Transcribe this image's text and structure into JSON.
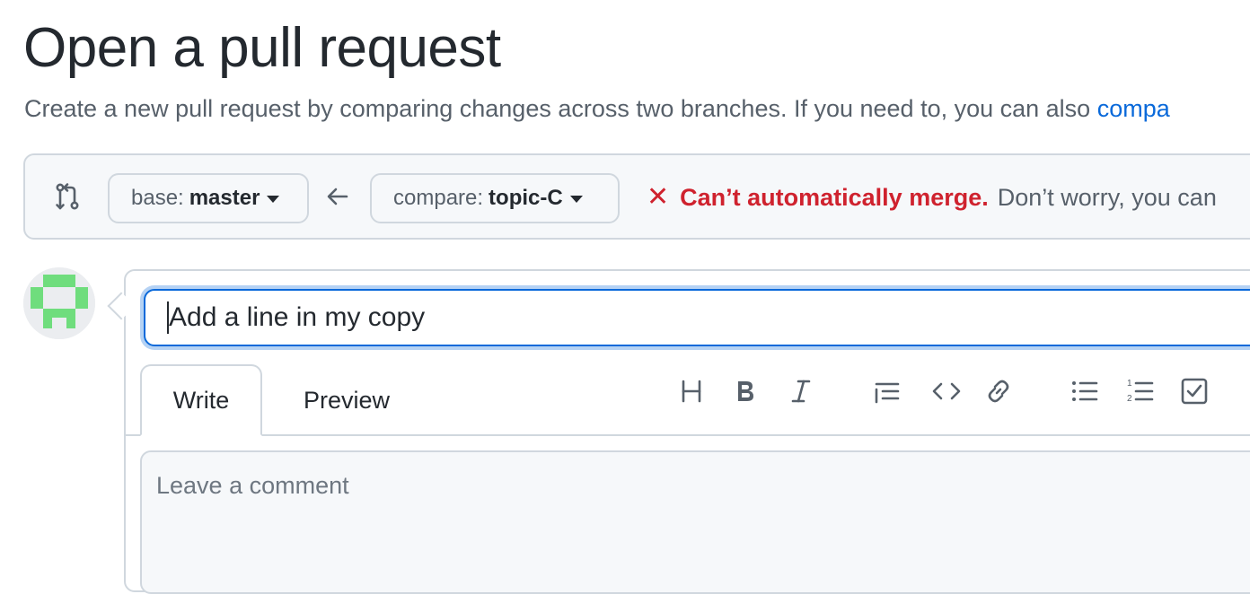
{
  "header": {
    "title": "Open a pull request",
    "subtitle_text": "Create a new pull request by comparing changes across two branches. If you need to, you can also ",
    "subtitle_link": "compa"
  },
  "range": {
    "base_prefix": "base:",
    "base_value": "master",
    "compare_prefix": "compare:",
    "compare_value": "topic-C",
    "merge_icon": "✕",
    "merge_status": "Can’t automatically merge.",
    "merge_hint": "Don’t worry, you can"
  },
  "composer": {
    "title_value": "Add a line in my copy",
    "tabs": [
      "Write",
      "Preview"
    ],
    "comment_placeholder": "Leave a comment",
    "toolbar_icons": [
      "heading-icon",
      "bold-icon",
      "italic-icon",
      "quote-icon",
      "code-icon",
      "link-icon",
      "bulleted-list-icon",
      "numbered-list-icon",
      "task-list-icon"
    ]
  },
  "colors": {
    "accent": "#0969da",
    "danger": "#cf222e",
    "muted": "#57606a",
    "avatar_green": "#6fdd7d"
  }
}
